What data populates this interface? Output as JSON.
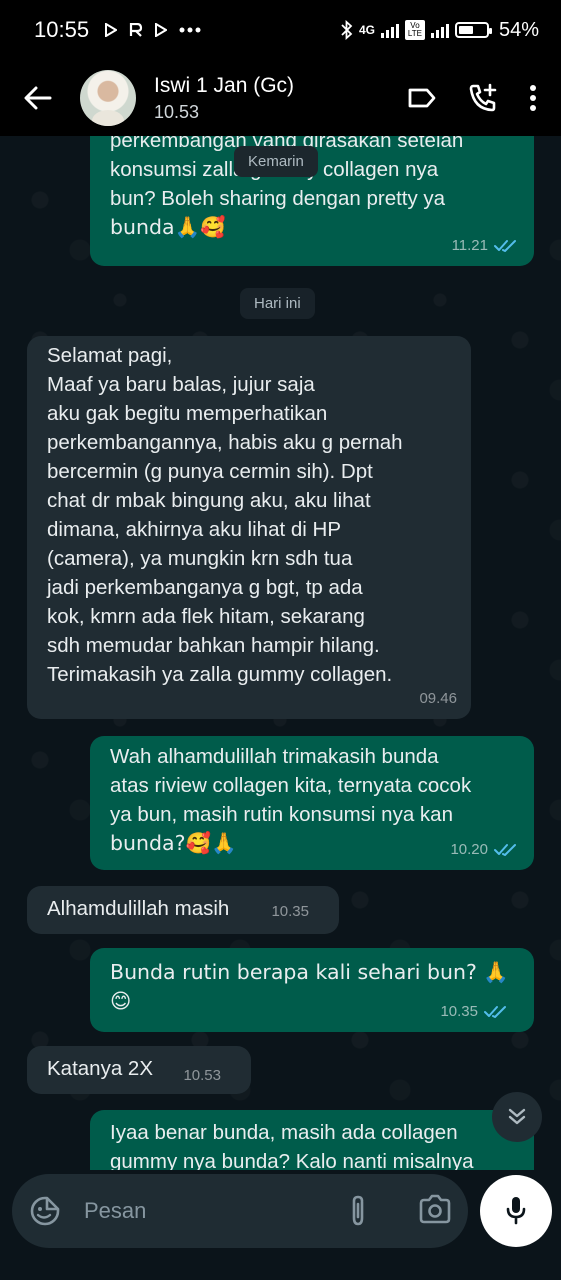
{
  "status_bar": {
    "time": "10:55",
    "network": "4G",
    "volte": "Vo LTE",
    "battery": "54%",
    "battery_level": 0.54,
    "notification_icons": [
      "play-icon",
      "r-app-icon",
      "play-icon",
      "more-dots-icon"
    ]
  },
  "header": {
    "contact_name": "Iswi 1 Jan (Gc)",
    "subtitle": "10.53"
  },
  "chat": {
    "sticky_date": "Kemarin",
    "messages": [
      {
        "dir": "out",
        "lines": [
          "perkembangan yang dirasakan setelah",
          "konsumsi zalla gummy collagen nya",
          "bun? Boleh sharing dengan pretty ya",
          "bunda🙏🥰"
        ],
        "time": "11.21",
        "read": true
      },
      {
        "type": "date",
        "label": "Hari ini"
      },
      {
        "dir": "in",
        "lines": [
          "Selamat pagi,",
          "Maaf ya baru balas, jujur saja",
          "aku gak begitu memperhatikan",
          "perkembangannya, habis aku g pernah",
          "bercermin (g punya cermin sih). Dpt",
          "chat dr mbak bingung aku, aku lihat",
          "dimana, akhirnya aku lihat di HP",
          "(camera), ya mungkin krn sdh tua",
          "jadi perkembanganya g bgt, tp ada",
          "kok, kmrn ada flek hitam, sekarang",
          "sdh memudar bahkan hampir hilang.",
          "Terimakasih ya zalla gummy collagen."
        ],
        "time": "09.46"
      },
      {
        "dir": "out",
        "lines": [
          "Wah alhamdulillah trimakasih bunda",
          "atas riview collagen kita, ternyata cocok",
          "ya bun, masih rutin konsumsi nya kan",
          "bunda?🥰🙏"
        ],
        "time": "10.20",
        "read": true
      },
      {
        "dir": "in",
        "lines": [
          "Alhamdulillah masih"
        ],
        "time": "10.35"
      },
      {
        "dir": "out",
        "lines": [
          "Bunda rutin berapa kali sehari bun? 🙏",
          "😊"
        ],
        "time": "10.35",
        "read": true
      },
      {
        "dir": "in",
        "lines": [
          "Katanya 2X"
        ],
        "time": "10.53"
      },
      {
        "dir": "out",
        "lines": [
          "Iyaa benar bunda, masih ada collagen",
          "gummy nya bunda? Kalo nanti misalnya"
        ],
        "partial": true
      }
    ]
  },
  "input": {
    "placeholder": "Pesan"
  },
  "colors": {
    "background": "#0b141a",
    "outgoing_bubble": "#005c4b",
    "incoming_bubble": "#202c33",
    "read_ticks": "#53bdeb"
  }
}
